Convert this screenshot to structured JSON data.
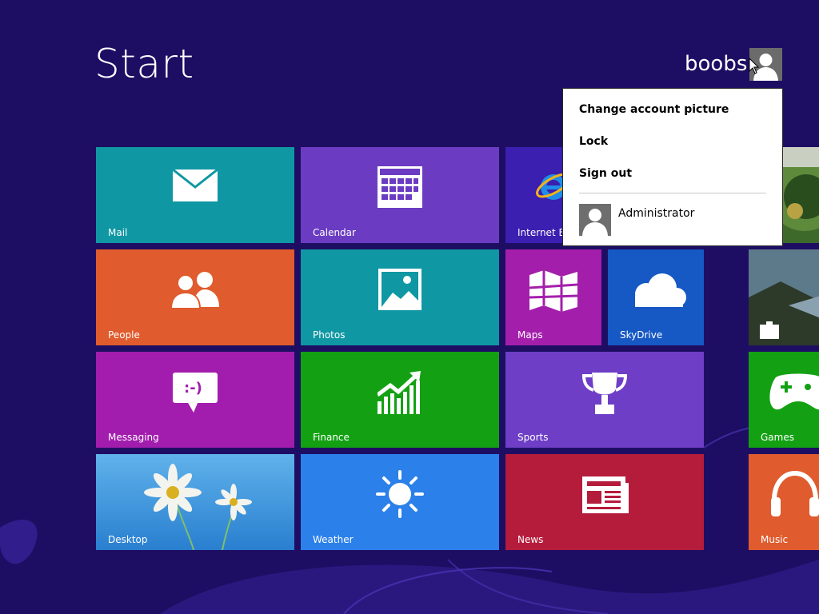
{
  "screen": {
    "title": "Start",
    "user_name": "boobs"
  },
  "tiles": [
    {
      "label": "Mail",
      "icon": "mail-icon",
      "color": "#0f97a3"
    },
    {
      "label": "Calendar",
      "icon": "calendar-icon",
      "color": "#6b3cc2"
    },
    {
      "label": "Internet Ex",
      "icon": "internet-explorer-icon",
      "color": "#3a1fb0"
    },
    {
      "label": "",
      "icon": "photo-landscape",
      "color": "#4b7b33"
    },
    {
      "label": "People",
      "icon": "people-icon",
      "color": "#e05b2d"
    },
    {
      "label": "Photos",
      "icon": "photos-icon",
      "color": "#0f97a3"
    },
    {
      "label": "Maps",
      "icon": "map-icon",
      "color": "#a31fab"
    },
    {
      "label": "SkyDrive",
      "icon": "cloud-icon",
      "color": "#1658c4"
    },
    {
      "label": "",
      "icon": "travel-suitcase-icon",
      "color": "#4a5860"
    },
    {
      "label": "Messaging",
      "icon": "message-smiley-icon",
      "color": "#a21dae"
    },
    {
      "label": "Finance",
      "icon": "chart-up-icon",
      "color": "#13a113"
    },
    {
      "label": "Sports",
      "icon": "trophy-icon",
      "color": "#6e3ec6"
    },
    {
      "label": "Games",
      "icon": "game-controller-icon",
      "color": "#13a113"
    },
    {
      "label": "Desktop",
      "icon": "daisy-wallpaper",
      "color": "#3a8fdc"
    },
    {
      "label": "Weather",
      "icon": "sun-icon",
      "color": "#2b80ea"
    },
    {
      "label": "News",
      "icon": "newspaper-icon",
      "color": "#b51c3c"
    },
    {
      "label": "Music",
      "icon": "headphones-icon",
      "color": "#e05b2d"
    }
  ],
  "account_menu": {
    "items": [
      "Change account picture",
      "Lock",
      "Sign out"
    ],
    "other_user": "Administrator"
  },
  "colors": {
    "background": "#1e0e63",
    "menu_bg": "#ffffff"
  }
}
